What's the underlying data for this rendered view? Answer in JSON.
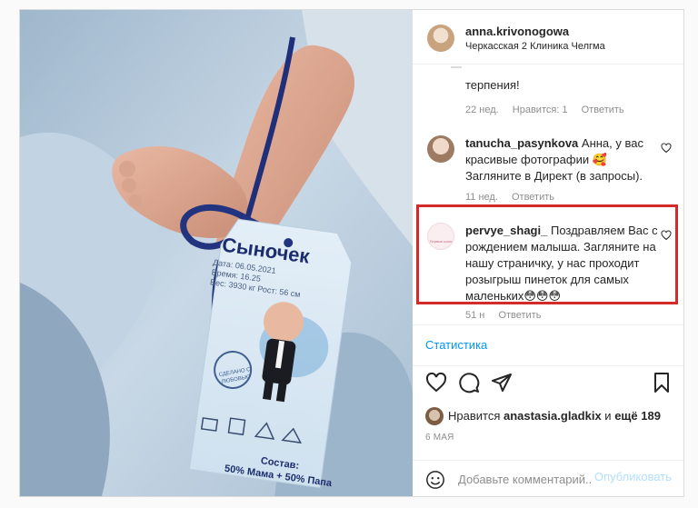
{
  "header": {
    "username": "anna.krivonogowa",
    "location": "Черкасская 2 Клиника Челгма"
  },
  "comments": [
    {
      "text": "терпения!",
      "time": "22 нед.",
      "likes": "Нравится: 1",
      "reply": "Ответить"
    },
    {
      "username": "tanucha_pasynkova",
      "text": "Анна, у вас красивые фотографии 🥰 Загляните в Директ (в запросы).",
      "time": "11 нед.",
      "reply": "Ответить"
    },
    {
      "username": "pervye_shagi_",
      "avatar_label": "Первые шаги",
      "text": "Поздравляем Вас с рождением малыша. Загляните на нашу страничку, у нас проходит розыгрыш пинеток для самых маленьких😳😳😳",
      "time": "51 н",
      "reply": "Ответить"
    }
  ],
  "stats_link": "Статистика",
  "likes": {
    "prefix": "Нравится",
    "user": "anastasia.gladkix",
    "and": "и",
    "more": "ещё 189"
  },
  "date": "6 МАЯ",
  "add_comment": {
    "placeholder": "Добавьте комментарий...",
    "publish": "Опубликовать"
  },
  "photo_tag": {
    "title": "Сыночек",
    "lines": [
      "Дата: 06.05.2021",
      "Время: 16.25",
      "Вес: 3930 кг   Рост: 56 см"
    ],
    "stamp": "СДЕЛАНО С ЛЮБОВЬЮ",
    "composition_label": "Состав:",
    "composition": "50% Мама + 50% Папа"
  },
  "colors": {
    "link": "#0095f6",
    "highlight": "#d62929",
    "publish_disabled": "#b2dffc",
    "meta": "#8e8e8e"
  }
}
